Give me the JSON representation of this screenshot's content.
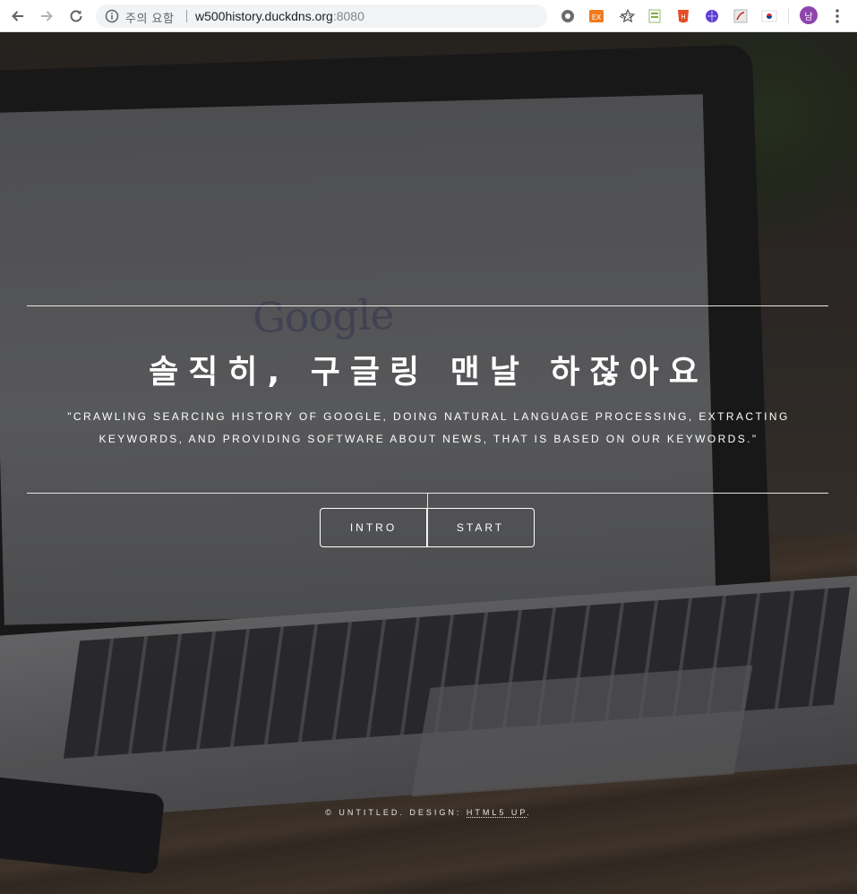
{
  "browser": {
    "status_text": "주의 요함",
    "url_host": "w500history.duckdns.org",
    "url_port": ":8080",
    "avatar_initial": "남",
    "accent": "#8e44ad",
    "extensions": [
      "settings-gear-icon",
      "orange-ex-icon",
      "dev-code-icon",
      "spreadsheet-icon",
      "html5-icon",
      "purple-globe-icon",
      "pdf-icon",
      "korea-flag-icon"
    ]
  },
  "banner": {
    "title": "솔직히, 구글링 맨날 하잖아요",
    "subtitle": "\"Crawling searcing history of google, doing natural language processing, extracting keywords, and providing software about news, that is based on our keywords.\"",
    "buttons": {
      "intro_label": "INTRO",
      "start_label": "START"
    }
  },
  "footer": {
    "copyright": "© UNTITLED. DESIGN:",
    "credit_link": "HTML5 UP",
    "trailing": "."
  }
}
